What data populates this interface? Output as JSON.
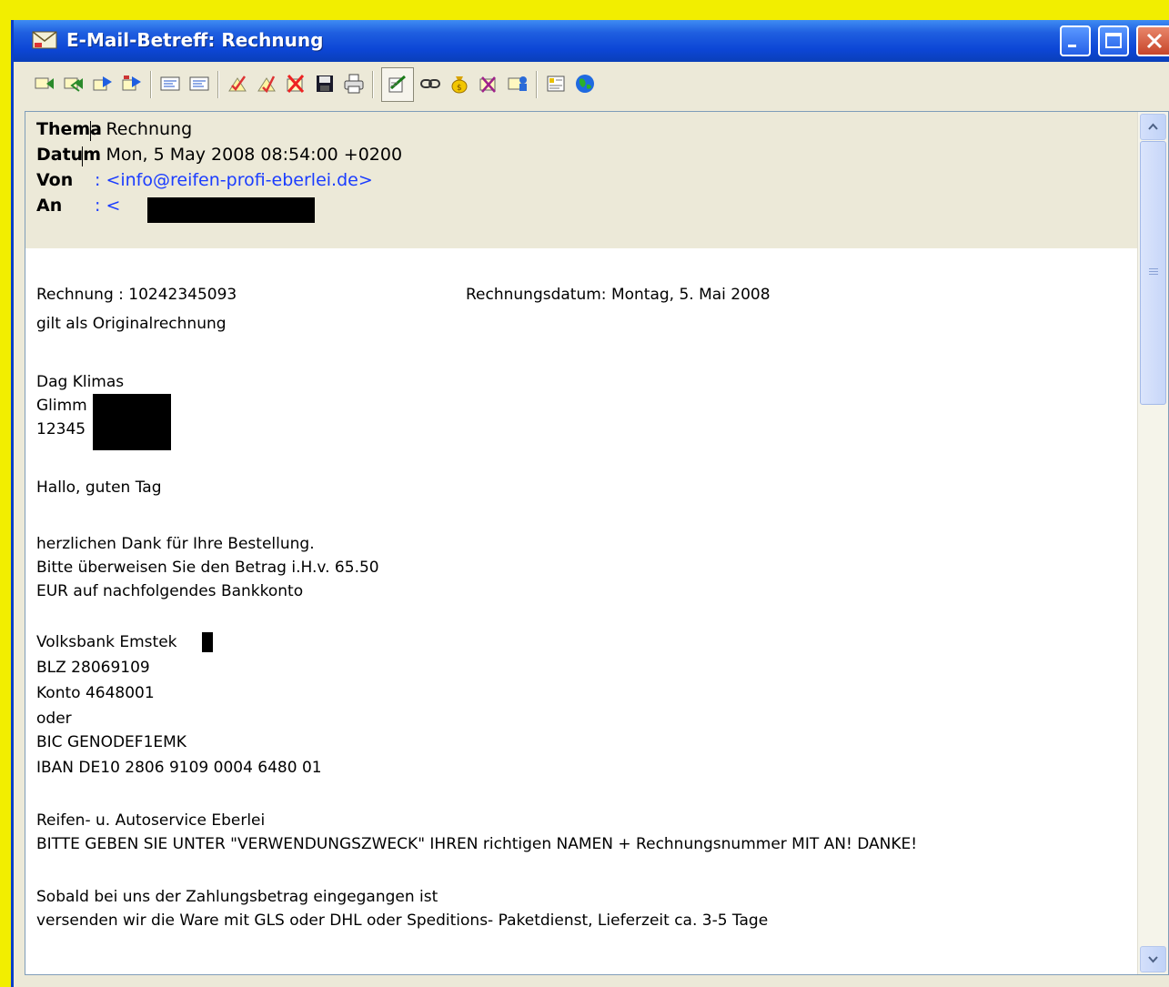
{
  "window": {
    "title": "E-Mail-Betreff: Rechnung"
  },
  "toolbar": {
    "icons": [
      "reply-icon",
      "reply-all-icon",
      "forward-icon",
      "forward-attachment-icon",
      "previous-message-icon",
      "next-message-icon",
      "mark-read-icon",
      "mark-unread-icon",
      "delete-icon",
      "save-icon",
      "print-icon",
      "show-html-icon",
      "link-icon",
      "money-bag-icon",
      "spam-icon",
      "address-book-icon",
      "properties-icon",
      "globe-icon"
    ]
  },
  "header": {
    "subject_label": "Thema",
    "subject_value": ": Rechnung",
    "date_label": "Datum",
    "date_value": ": Mon, 5 May 2008 08:54:00 +0200",
    "from_label": "Von",
    "from_value": ": <info@reifen-profi-eberlei.de>",
    "to_label": "An",
    "to_value_prefix": ": <",
    "to_value_suffix": ">"
  },
  "body": {
    "invoice_number": "Rechnung : 10242345093",
    "invoice_date": "Rechnungsdatum: Montag, 5. Mai 2008",
    "original_invoice": "gilt als Originalrechnung",
    "recipient_name": "Dag Klimas",
    "recipient_street_start": "Glimm",
    "recipient_city_start": "12345",
    "greeting": "Hallo, guten Tag",
    "thanks": "herzlichen Dank für Ihre Bestellung.",
    "transfer_request": "Bitte überweisen Sie den Betrag i.H.v. 65.50",
    "transfer_account": "EUR auf nachfolgendes Bankkonto",
    "bank_name": "Volksbank Emstek",
    "blz": "BLZ 28069109",
    "konto": "Konto 4648001",
    "oder": "oder",
    "bic": "BIC GENODEF1EMK",
    "iban": "IBAN DE10 2806 9109 0004 6480 01",
    "company": "Reifen- u. Autoservice Eberlei",
    "instructions": "BITTE GEBEN SIE UNTER \"VERWENDUNGSZWECK\" IHREN richtigen NAMEN + Rechnungsnummer MIT AN! DANKE!",
    "payment_received": "Sobald bei uns der Zahlungsbetrag eingegangen ist",
    "shipping": "versenden wir die Ware mit GLS oder DHL oder Speditions- Paketdienst,   Lieferzeit ca. 3-5 Tage"
  }
}
